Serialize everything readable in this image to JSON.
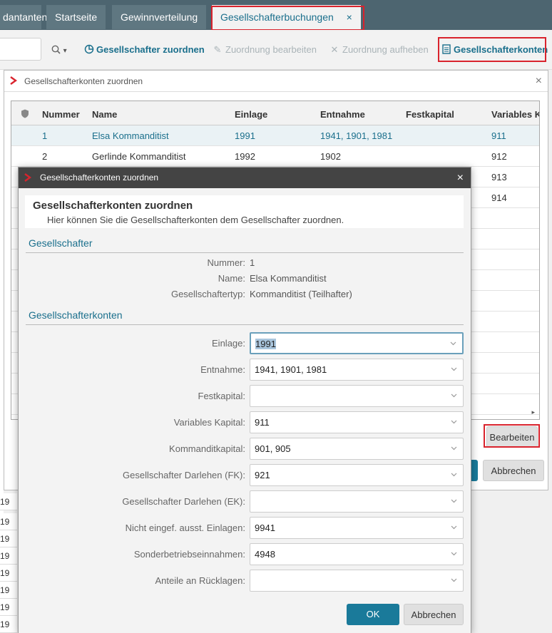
{
  "tabs": [
    {
      "label": "dantan­ten"
    },
    {
      "label": "Startseite"
    },
    {
      "label": "Gewinnverteilung"
    },
    {
      "label": "Gesellschafterbuchungen",
      "close": "×"
    }
  ],
  "toolbar": {
    "search_dropdown": "▾",
    "assign": "Gesellschafter zuordnen",
    "edit_assignment": "Zuordnung bearbeiten",
    "remove_assignment": "Zuordnung aufheben",
    "accounts": "Gesellschafterkonten"
  },
  "bg_rows": [
    "19",
    "19",
    "19",
    "19",
    "19",
    "19",
    "19",
    "19"
  ],
  "outer_dialog": {
    "title": "Gesellschafterkonten zuordnen",
    "close": "×",
    "columns": [
      "Nummer",
      "Name",
      "Einlage",
      "Entnahme",
      "Festkapital",
      "Variables Ka"
    ],
    "rows": [
      {
        "nummer": "1",
        "name": "Elsa Kommanditist",
        "einlage": "1991",
        "entnahme": "1941, 1901, 1981",
        "festkapital": "",
        "variables": "911"
      },
      {
        "nummer": "2",
        "name": "Gerlinde Kommanditist",
        "einlage": "1992",
        "entnahme": "1902",
        "festkapital": "",
        "variables": "912"
      },
      {
        "nummer": "",
        "name": "",
        "einlage": "",
        "entnahme": "",
        "festkapital": "",
        "variables": "913"
      },
      {
        "nummer": "",
        "name": "",
        "einlage": "",
        "entnahme": "",
        "festkapital": "",
        "variables": "914"
      }
    ],
    "edit_button": "Bearbeiten",
    "cancel_button": "Abbrechen"
  },
  "inner_dialog": {
    "title": "Gesellschafterkonten zuordnen",
    "close": "×",
    "heading": "Gesellschafterkonten zuordnen",
    "description": "Hier können Sie die Gesellschafterkonten dem Gesellschafter zuordnen.",
    "section_partner": "Gesellschafter",
    "partner": [
      {
        "key": "Nummer:",
        "value": "1"
      },
      {
        "key": "Name:",
        "value": "Elsa Kommanditist"
      },
      {
        "key": "Gesellschaftertyp:",
        "value": "Kommanditist (Teilhafter)"
      }
    ],
    "section_accounts": "Gesellschafterkonten",
    "fields": [
      {
        "label": "Einlage:",
        "value": "1991"
      },
      {
        "label": "Entnahme:",
        "value": "1941, 1901, 1981"
      },
      {
        "label": "Festkapital:",
        "value": ""
      },
      {
        "label": "Variables Kapital:",
        "value": "911"
      },
      {
        "label": "Kommanditkapital:",
        "value": "901, 905"
      },
      {
        "label": "Gesellschafter Darlehen (FK):",
        "value": "921"
      },
      {
        "label": "Gesellschafter Darlehen (EK):",
        "value": ""
      },
      {
        "label": "Nicht eingef. ausst. Einlagen:",
        "value": "9941"
      },
      {
        "label": "Sonderbetriebseinnahmen:",
        "value": "4948"
      },
      {
        "label": "Anteile an Rücklagen:",
        "value": ""
      }
    ],
    "ok_button": "OK",
    "cancel_button": "Abbrechen"
  },
  "colors": {
    "accent": "#1a6f8c",
    "highlight": "#d9232d",
    "titlebar": "#444444"
  }
}
